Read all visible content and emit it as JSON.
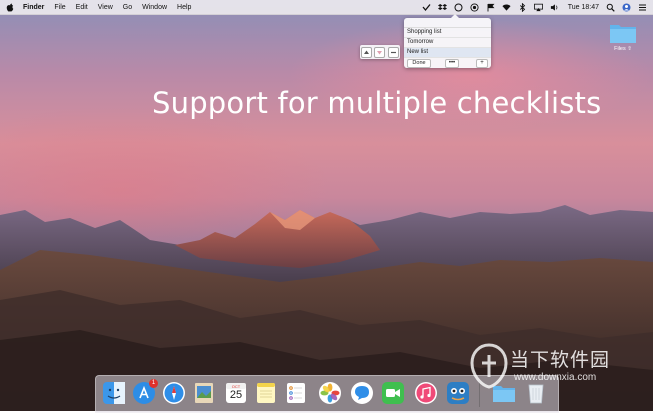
{
  "menubar": {
    "app": "Finder",
    "menus": [
      "File",
      "Edit",
      "View",
      "Go",
      "Window",
      "Help"
    ],
    "clock": "Tue 18:47",
    "status_icons": [
      "checklist-icon",
      "dropbox-icon",
      "circle-icon",
      "target-icon",
      "flag-icon",
      "wifi-icon",
      "bluetooth-icon",
      "airplay-icon",
      "volume-icon",
      "spotlight-icon",
      "user-icon",
      "notification-icon"
    ]
  },
  "popover": {
    "lists": [
      "Shopping list",
      "Tomorrow",
      "New list"
    ],
    "active_index": 2,
    "done_label": "Done",
    "more_label": "•••",
    "add_label": "+"
  },
  "toolbar": {
    "buttons": [
      "up-arrow-icon",
      "down-arrow-icon",
      "delete-icon"
    ]
  },
  "headline": "Support for multiple checklists",
  "desktop": {
    "folder_label": "Files ⇧"
  },
  "dock": {
    "apps": [
      "finder-icon",
      "app-store-icon",
      "safari-icon",
      "preview-icon",
      "calendar-icon",
      "notes-icon",
      "reminders-icon",
      "photos-icon",
      "messages-icon",
      "facetime-icon",
      "itunes-icon",
      "app-icon",
      "folder-icon",
      "trash-icon"
    ],
    "calendar": {
      "month": "OCT",
      "day": "25"
    },
    "app_store_badge": "1"
  },
  "watermark": {
    "cn": "当下软件园",
    "url": "www.downxia.com"
  },
  "colors": {
    "accent": "#2f7fe0",
    "menubar": "#ece9ee",
    "badge": "#e0312b"
  }
}
